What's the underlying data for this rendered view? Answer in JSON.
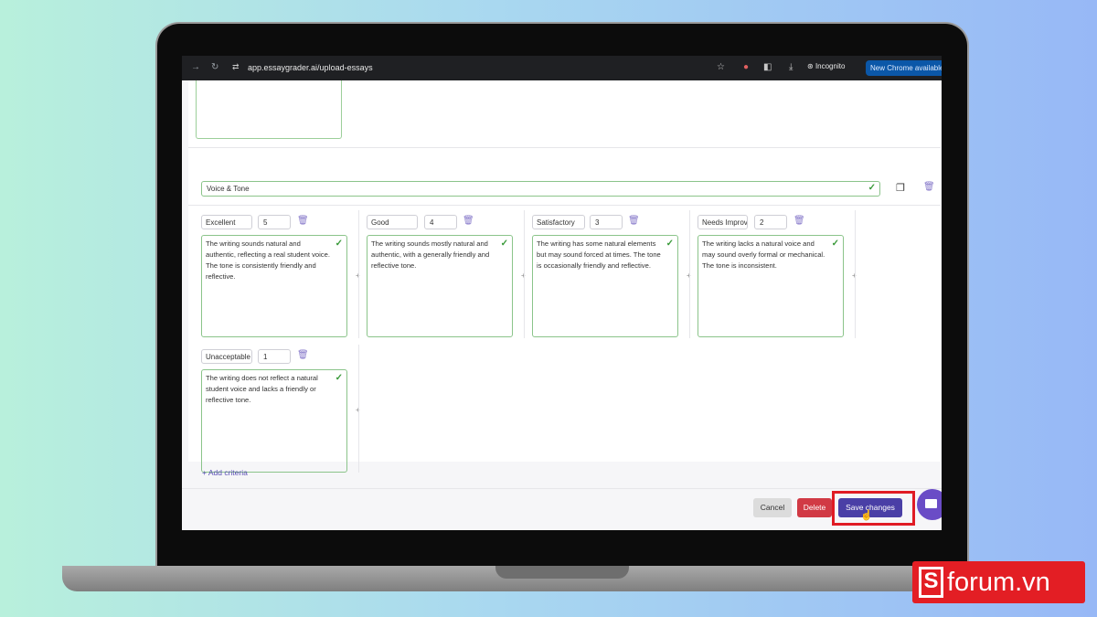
{
  "browser": {
    "url": "app.essaygrader.ai/upload-essays",
    "incognito_label": "Incognito",
    "new_chrome_label": "New Chrome available"
  },
  "criterion": {
    "name": "Voice & Tone",
    "levels": [
      {
        "name": "Excellent",
        "score": "5",
        "description": "The writing sounds natural and authentic, reflecting a real student voice. The tone is consistently friendly and reflective."
      },
      {
        "name": "Good",
        "score": "4",
        "description": "The writing sounds mostly natural and authentic, with a generally friendly and reflective tone."
      },
      {
        "name": "Satisfactory",
        "score": "3",
        "description": "The writing has some natural elements but may sound forced at times. The tone is occasionally friendly and reflective."
      },
      {
        "name": "Needs Improv",
        "score": "2",
        "description": "The writing lacks a natural voice and may sound overly formal or mechanical. The tone is inconsistent."
      },
      {
        "name": "Unacceptable",
        "score": "1",
        "description": "The writing does not reflect a natural student voice and lacks a friendly or reflective tone."
      }
    ]
  },
  "add_criteria_label": "+ Add criteria",
  "footer": {
    "cancel_label": "Cancel",
    "delete_label": "Delete",
    "save_label": "Save changes"
  },
  "watermark": {
    "mark": "S",
    "text": "forum.vn"
  },
  "colors": {
    "accent": "#4a3fa6",
    "danger": "#d13a45",
    "valid_border": "#8bc48a",
    "highlight": "#e01b24",
    "brand": "#e31e24"
  }
}
